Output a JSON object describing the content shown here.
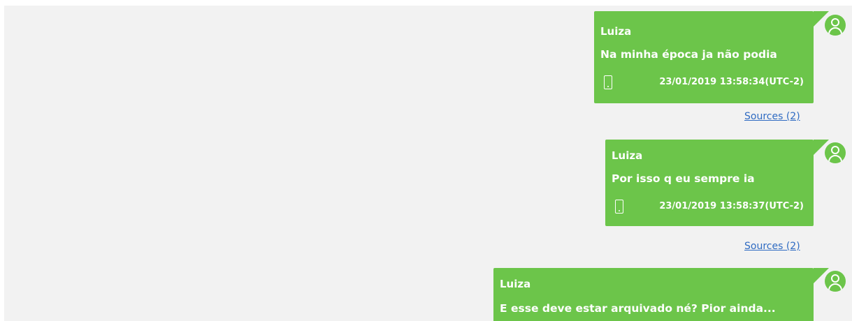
{
  "messages": [
    {
      "sender": "Luiza",
      "text": "Na minha época ja não podia",
      "timestamp": "23/01/2019 13:58:34(UTC-2)",
      "source_icon": "phone-icon",
      "sources_label": "Sources (2)"
    },
    {
      "sender": "Luiza",
      "text": "Por isso q eu sempre ia",
      "timestamp": "23/01/2019 13:58:37(UTC-2)",
      "source_icon": "phone-icon",
      "sources_label": "Sources (2)"
    },
    {
      "sender": "Luiza",
      "text": "E esse deve estar arquivado né? Pior ainda...",
      "source_icon": "phone-icon"
    }
  ],
  "colors": {
    "bubble": "#6cc54a",
    "background": "#f2f2f2",
    "link": "#2f6bc2"
  },
  "icons": {
    "avatar": "user-avatar-icon",
    "device": "phone-icon"
  }
}
